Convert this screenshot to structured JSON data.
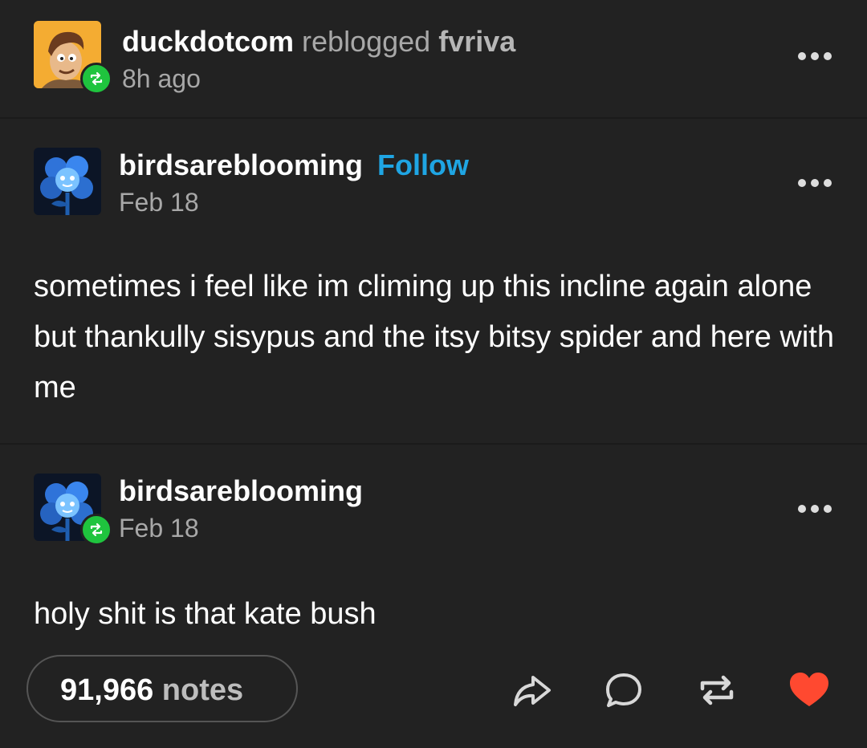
{
  "reblog_header": {
    "username": "duckdotcom",
    "action": "reblogged",
    "source": "fvriva",
    "time": "8h ago",
    "avatar_icon": "cartoon-man-avatar",
    "badge_icon": "reblog-icon"
  },
  "original_post": {
    "username": "birdsareblooming",
    "follow_label": "Follow",
    "date": "Feb 18",
    "avatar_icon": "blue-flower-avatar",
    "body": "sometimes i feel like im climing up this incline again alone but thankully sisypus and the itsy bitsy spider and here with me"
  },
  "reply_post": {
    "username": "birdsareblooming",
    "date": "Feb 18",
    "avatar_icon": "blue-flower-avatar",
    "badge_icon": "reblog-icon",
    "body": "holy shit is that kate bush"
  },
  "footer": {
    "notes_count": "91,966",
    "notes_label": "notes",
    "share_icon": "share-icon",
    "reply_icon": "comment-icon",
    "reblog_icon": "reblog-icon",
    "like_icon": "heart-icon",
    "like_color": "#ff4930"
  },
  "colors": {
    "background": "#222222",
    "follow": "#1fa5e3",
    "reblog_badge": "#1fc43e"
  }
}
